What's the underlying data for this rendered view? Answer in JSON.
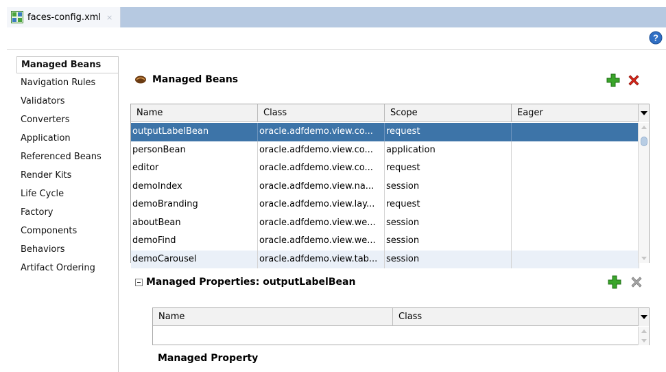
{
  "tab": {
    "title": "faces-config.xml",
    "close": "×",
    "file_icon": "faces-config-file-icon"
  },
  "help": {
    "icon": "help-icon"
  },
  "nav": {
    "items": [
      {
        "label": "Managed Beans",
        "active": true
      },
      {
        "label": "Navigation Rules"
      },
      {
        "label": "Validators"
      },
      {
        "label": "Converters"
      },
      {
        "label": "Application"
      },
      {
        "label": "Referenced Beans"
      },
      {
        "label": "Render Kits"
      },
      {
        "label": "Life Cycle"
      },
      {
        "label": "Factory"
      },
      {
        "label": "Components"
      },
      {
        "label": "Behaviors"
      },
      {
        "label": "Artifact Ordering"
      }
    ]
  },
  "beans": {
    "heading": "Managed Beans",
    "heading_icon": "bean-icon",
    "add_icon": "add-icon",
    "delete_icon": "delete-icon",
    "columns": [
      "Name",
      "Class",
      "Scope",
      "Eager"
    ],
    "rows": [
      {
        "name": "outputLabelBean",
        "class": "oracle.adfdemo.view.co...",
        "scope": "request",
        "eager": ""
      },
      {
        "name": "personBean",
        "class": "oracle.adfdemo.view.co...",
        "scope": "application",
        "eager": ""
      },
      {
        "name": "editor",
        "class": "oracle.adfdemo.view.co...",
        "scope": "request",
        "eager": ""
      },
      {
        "name": "demoIndex",
        "class": "oracle.adfdemo.view.na...",
        "scope": "session",
        "eager": ""
      },
      {
        "name": "demoBranding",
        "class": "oracle.adfdemo.view.lay...",
        "scope": "request",
        "eager": ""
      },
      {
        "name": "aboutBean",
        "class": "oracle.adfdemo.view.we...",
        "scope": "session",
        "eager": ""
      },
      {
        "name": "demoFind",
        "class": "oracle.adfdemo.view.we...",
        "scope": "session",
        "eager": ""
      },
      {
        "name": "demoCarousel",
        "class": "oracle.adfdemo.view.tab...",
        "scope": "session",
        "eager": ""
      }
    ]
  },
  "properties": {
    "heading": "Managed Properties: outputLabelBean",
    "columns": [
      "Name",
      "Class"
    ],
    "footer_label": "Managed Property"
  },
  "colors": {
    "selection": "#3d74a8",
    "tabstrip": "#b6c9e1",
    "add_green": "#2e9b1f",
    "delete_red": "#d21f14"
  }
}
